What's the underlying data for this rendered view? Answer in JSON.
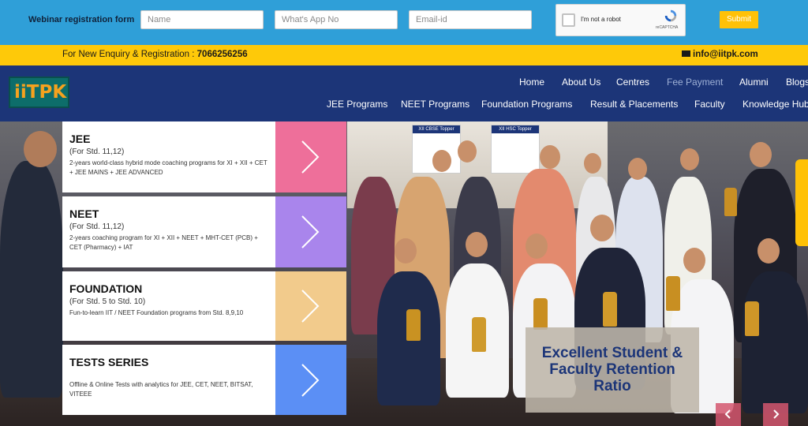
{
  "webinar": {
    "title": "Webinar registration form",
    "name_placeholder": "Name",
    "app_placeholder": "What's App No",
    "email_placeholder": "Email-id",
    "captcha_label": "I'm not a robot",
    "captcha_brand": "reCAPTCHA",
    "submit_label": "Submit"
  },
  "enquiry": {
    "text": "For New Enquiry & Registration : ",
    "phone": "7066256256",
    "email": "info@iitpk.com"
  },
  "brand": {
    "logo_text": "iiTPK"
  },
  "nav": {
    "row1": [
      "Home",
      "About Us",
      "Centres",
      "Fee Payment",
      "Alumni",
      "Blogs"
    ],
    "row2": [
      "JEE Programs",
      "NEET Programs",
      "Foundation Programs",
      "Result & Placements",
      "Faculty",
      "Knowledge Hub"
    ]
  },
  "cards": [
    {
      "title": "JEE",
      "sub": "(For Std. 11,12)",
      "desc": "2-years world-class hybrid mode coaching programs for XI + XII + CET + JEE MAINS + JEE ADVANCED",
      "color": "#ee6f9a"
    },
    {
      "title": "NEET",
      "sub": "(For Std. 11,12)",
      "desc": "2-years coaching program for XI + XII + NEET + MHT-CET (PCB) + CET (Pharmacy) + IAT",
      "color": "#a985ec"
    },
    {
      "title": "FOUNDATION",
      "sub": "(For Std. 5 to Std. 10)",
      "desc": "Fun-to-learn IIT / NEET Foundation programs from Std. 8,9,10",
      "color": "#f2cb8c"
    },
    {
      "title": "TESTS SERIES",
      "sub": "",
      "desc": "Offline & Online Tests with analytics for JEE, CET, NEET, BITSAT, VITEEE",
      "color": "#5b8ff5"
    }
  ],
  "hero": {
    "retention_text": "Excellent Student & Faculty Retention Ratio",
    "topper_1": "XII CBSE Topper",
    "topper_2": "XII HSC Topper"
  },
  "colors": {
    "topbar": "#2f9fd8",
    "enquiry_bar": "#fec909",
    "nav": "#1c3578",
    "submit": "#ffc107"
  }
}
